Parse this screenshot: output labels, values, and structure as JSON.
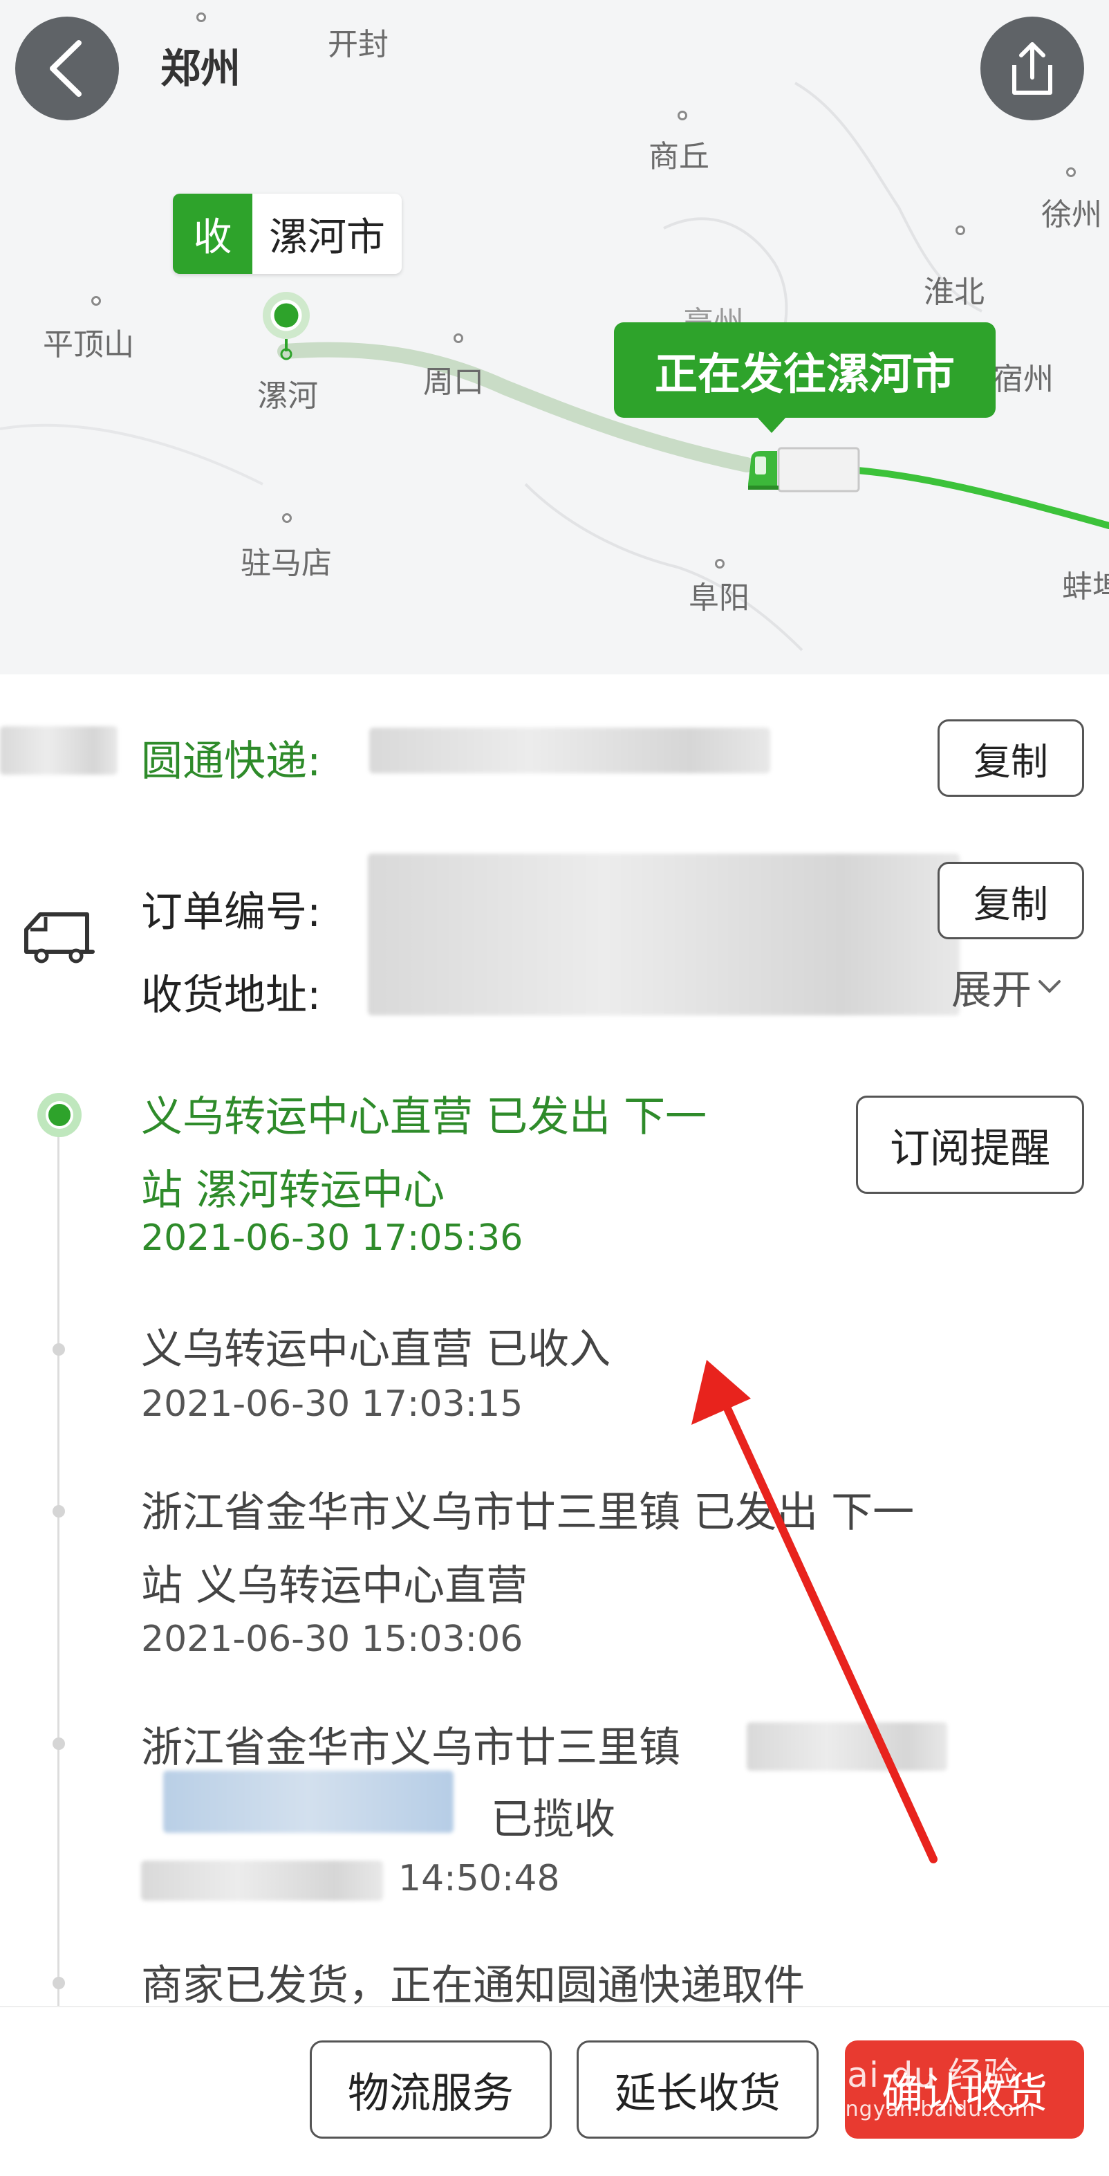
{
  "map": {
    "top_city": "郑州",
    "cities": [
      "开封",
      "商丘",
      "徐州",
      "平顶山",
      "漯河",
      "周口",
      "淮北",
      "驻马店",
      "阜阳",
      "蚌埠",
      "亳州",
      "宿州"
    ],
    "destination_badge": "收",
    "destination_name": "漯河市",
    "status_bubble": "正在发往漯河市"
  },
  "info": {
    "courier_label": "圆通快递:",
    "copy_label": "复制",
    "order_label": "订单编号:",
    "order_copy_label": "复制",
    "address_label": "收货地址:",
    "expand_label": "展开"
  },
  "timeline": {
    "subscribe_label": "订阅提醒",
    "events": [
      {
        "line1": "义乌转运中心直营  已发出  下一",
        "line2": "站    漯河转运中心",
        "time": "2021-06-30  17:05:36"
      },
      {
        "line1": "义乌转运中心直营  已收入",
        "time": "2021-06-30  17:03:15"
      },
      {
        "line1": "浙江省金华市义乌市廿三里镇  已发出  下一",
        "line2": "站    义乌转运中心直营",
        "time": "2021-06-30  15:03:06"
      },
      {
        "line1": "浙江省金华市义乌市廿三里镇",
        "line2": "已揽收",
        "time": "14:50:48"
      },
      {
        "line1": "商家已发货，正在通知圆通快递取件"
      }
    ]
  },
  "footer": {
    "logistics_label": "物流服务",
    "extend_label": "延长收货",
    "confirm_label": "确认收货"
  },
  "watermark": {
    "main": "Bai du 经验",
    "sub": "jingyan.baidu.com"
  },
  "colors": {
    "accent_green": "#2ea32b",
    "confirm_red": "#e83a30",
    "route_green": "#3cc23a"
  }
}
